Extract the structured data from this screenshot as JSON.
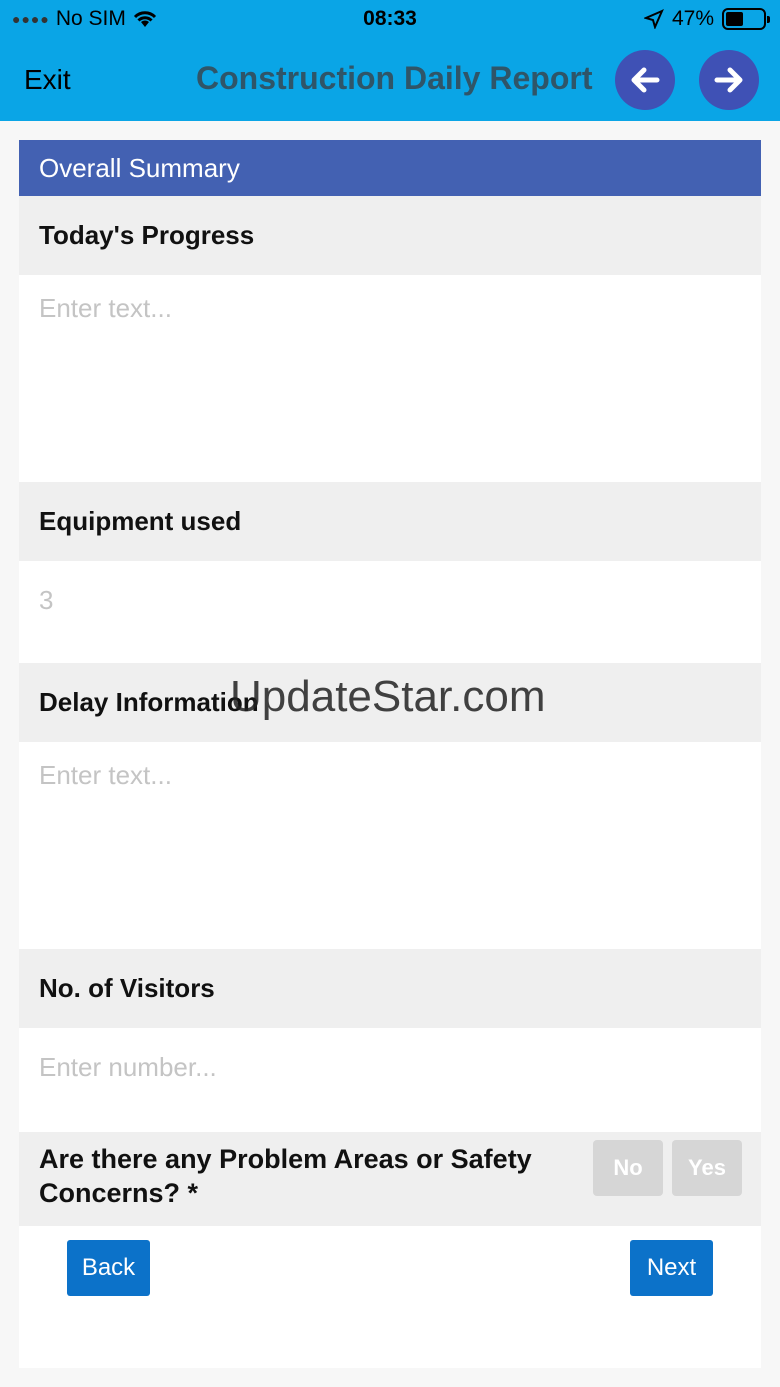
{
  "status_bar": {
    "carrier": "No SIM",
    "time": "08:33",
    "battery": "47%",
    "battery_level": 0.47
  },
  "nav": {
    "exit_label": "Exit",
    "title": "Construction Daily Report",
    "prev_icon": "arrow-left-icon",
    "next_icon": "arrow-right-icon"
  },
  "form": {
    "section_title": "Overall Summary",
    "fields": [
      {
        "label": "Today's Progress",
        "value": "",
        "placeholder": "Enter text..."
      },
      {
        "label": "Equipment used",
        "value": "3",
        "placeholder": ""
      },
      {
        "label": "Delay Information",
        "value": "",
        "placeholder": "Enter text..."
      },
      {
        "label": "No. of Visitors",
        "value": "",
        "placeholder": "Enter number..."
      }
    ],
    "question": {
      "text": "Are there any Problem Areas or Safety Concerns? *",
      "options": [
        "No",
        "Yes"
      ]
    },
    "back_label": "Back",
    "next_label": "Next"
  },
  "watermark": "UpdateStar.com",
  "colors": {
    "topbar": "#0aa5e6",
    "section_header": "#4361b2",
    "circle_button": "#3f51b5",
    "action_button": "#0c72c9"
  }
}
